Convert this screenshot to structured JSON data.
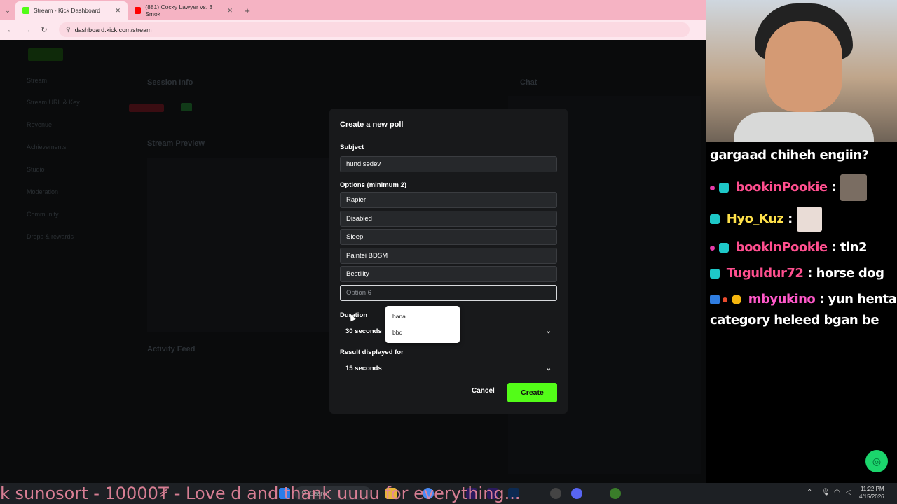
{
  "browser": {
    "tabs": [
      {
        "title": "Stream - Kick Dashboard",
        "favicon_color": "#53fc18"
      },
      {
        "title": "(881) Cocky Lawyer vs. 3 Smok",
        "favicon_color": "#ff0000"
      }
    ],
    "url": "dashboard.kick.com/stream"
  },
  "dashboard": {
    "sidebar": [
      "Stream",
      "Stream URL & Key",
      "Revenue",
      "Achievements",
      "Studio",
      "Moderation",
      "Community",
      "Drops & rewards"
    ],
    "panels": {
      "session_info": "Session Info",
      "stream_preview": "Stream Preview",
      "activity_feed": "Activity Feed",
      "chat": "Chat"
    }
  },
  "poll_modal": {
    "title": "Create a new poll",
    "subject_label": "Subject",
    "subject_value": "hund sedev",
    "options_label": "Options (minimum 2)",
    "options": [
      "Rapier",
      "Disabled",
      "Sleep",
      "Paintei BDSM",
      "Bestility"
    ],
    "option6_placeholder": "Option 6",
    "autocomplete": [
      "hana",
      "bbc"
    ],
    "duration_label": "Duration",
    "duration_value": "30 seconds",
    "result_label": "Result displayed for",
    "result_value": "15 seconds",
    "cancel_label": "Cancel",
    "create_label": "Create",
    "accent": "#53fc18"
  },
  "overlay_chat": [
    {
      "user": "",
      "text": "gargaad chiheh engiin?"
    },
    {
      "user": "bookinPookie",
      "text": ":"
    },
    {
      "user": "Hyo_Kuz",
      "text": ":"
    },
    {
      "user": "bookinPookie",
      "text": ": tin2"
    },
    {
      "user": "Tuguldur72",
      "text": ": horse dog"
    },
    {
      "user": "mbyukino",
      "text": ": yun hentai"
    },
    {
      "user": "",
      "text": "category heleed bgan be"
    }
  ],
  "taskbar": {
    "ticker": "k sunosort - 10000₮ - Love d and thank uuuu for everything...",
    "search_placeholder": "Search",
    "time": "11:22 PM",
    "date": "4/15/2026"
  }
}
